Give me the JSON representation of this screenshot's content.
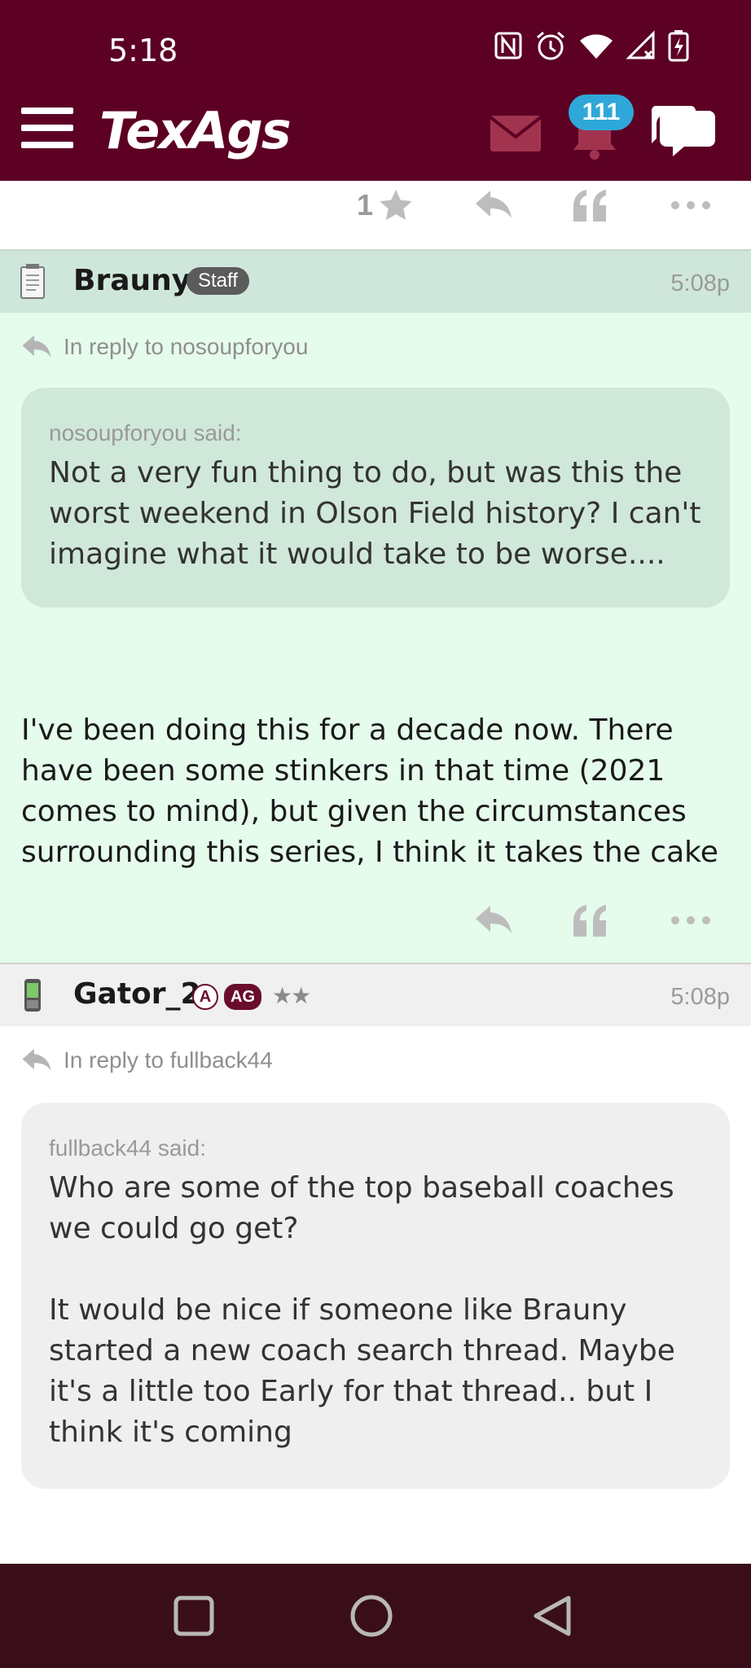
{
  "status_bar": {
    "time": "5:18",
    "icons": [
      "nfc-icon",
      "alarm-icon",
      "wifi-icon",
      "signal-icon",
      "battery-charging-icon"
    ]
  },
  "app_bar": {
    "logo": "TexAgs",
    "notifications_count": "111",
    "colors": {
      "bar": "#5c0024",
      "badge": "#2ea8d9"
    }
  },
  "previous_post_actions": {
    "like_count": "1"
  },
  "posts": [
    {
      "username": "Brauny",
      "badge": "Staff",
      "time": "5:08p",
      "reply_to": "In reply to nosoupforyou",
      "quote_author": "nosoupforyou said:",
      "quote_text": "Not a very fun thing to do, but was this the worst weekend in Olson Field history? I can't imagine what it would take to be worse....",
      "body": "I've been doing this for a decade now. There have been some stinkers in that time (2021 comes to mind), but given the circumstances surrounding this series, I think it takes the cake"
    },
    {
      "username": "Gator_2",
      "badge_a": "A",
      "badge_ag": "AG",
      "stars": "★★",
      "time": "5:08p",
      "reply_to": "In reply to fullback44",
      "quote_author": "fullback44 said:",
      "quote_text": "Who are some of the top baseball coaches we could go get?\n\nIt would be nice if someone like Brauny started a new coach search thread. Maybe it's a little too Early for that thread.. but I think it's coming"
    }
  ]
}
